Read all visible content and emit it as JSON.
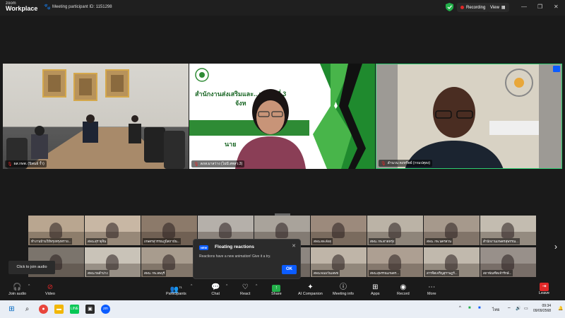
{
  "app": {
    "brand_top": "zoom",
    "brand_bottom": "Workplace"
  },
  "meeting": {
    "participant_id_text": "Meeting participant ID: 1151298"
  },
  "titlebar": {
    "recording_label": "Recording",
    "view_label": "View",
    "minimize": "—",
    "restore": "❐",
    "close": "✕"
  },
  "main_tiles": [
    {
      "name": "ผส.กษพ. (นิพนธ์ ร้ำ)"
    },
    {
      "name": "ลภส.มาสว่าง (ไม่มี.สพสว.3)",
      "slide_line1": "สำนักงานส่งเสริมและ...เกษตรที่ 3",
      "slide_line2": "จังห",
      "slide_line3": "นาย"
    },
    {
      "name": "ลำนวน คงทรัพย์ (กรมปศุสง)"
    }
  ],
  "thumbnails": [
    {
      "name": "ทำงานบ้านวิถีทรุงทรุงทราย..."
    },
    {
      "name": "สพน.สุรายุจิน"
    },
    {
      "name": "เกษตรสุวรรณภูมิสถาบัน..."
    },
    {
      "name": ""
    },
    {
      "name": ""
    },
    {
      "name": "สพน.ลพ.ดังสุ"
    },
    {
      "name": "สพน. กพ.ตาดหรุ่ง"
    },
    {
      "name": "สพน. กพ.นครสวน"
    },
    {
      "name": "สำนักงานเกษตรสุพรรณ..."
    },
    {
      "name": ""
    },
    {
      "name": "สพน.กพลำปาง"
    },
    {
      "name": "สพน. กพ.ลพบุรี"
    },
    {
      "name": "สำนักงานเกษตรสาขาน..."
    },
    {
      "name": ""
    },
    {
      "name": "สพน.พนมวันเลพช"
    },
    {
      "name": "สพน.สุพรรณเกษตร..."
    },
    {
      "name": "สารจิตเจริญสุราษฏร์..."
    },
    {
      "name": "สถาพัณฑิตเจ้ารีกษ์..."
    }
  ],
  "popup": {
    "badge": "NEW",
    "title": "Floating reactions",
    "body": "Reactions have a new animation! Give it a try.",
    "ok": "OK",
    "close": "✕"
  },
  "tooltip": {
    "text": "Click to join audio"
  },
  "toolbar": {
    "join_audio": "Join audio",
    "video": "Video",
    "participants": "Participants",
    "participants_count": "71",
    "chat": "Chat",
    "react": "React",
    "share": "Share",
    "ai_companion": "AI Companion",
    "meeting_info": "Meeting info",
    "apps": "Apps",
    "record": "Record",
    "more": "More",
    "leave": "Leave"
  },
  "taskbar": {
    "time": "09:34",
    "date": "09/09/2568",
    "lang": "ไทย"
  },
  "colors": {
    "accent": "#0b5cff",
    "recording": "#e02828",
    "active_border": "#2ecc71",
    "leave": "#e02828"
  },
  "icons": {
    "shield": "shield-check-icon",
    "paw": "paw-icon"
  }
}
